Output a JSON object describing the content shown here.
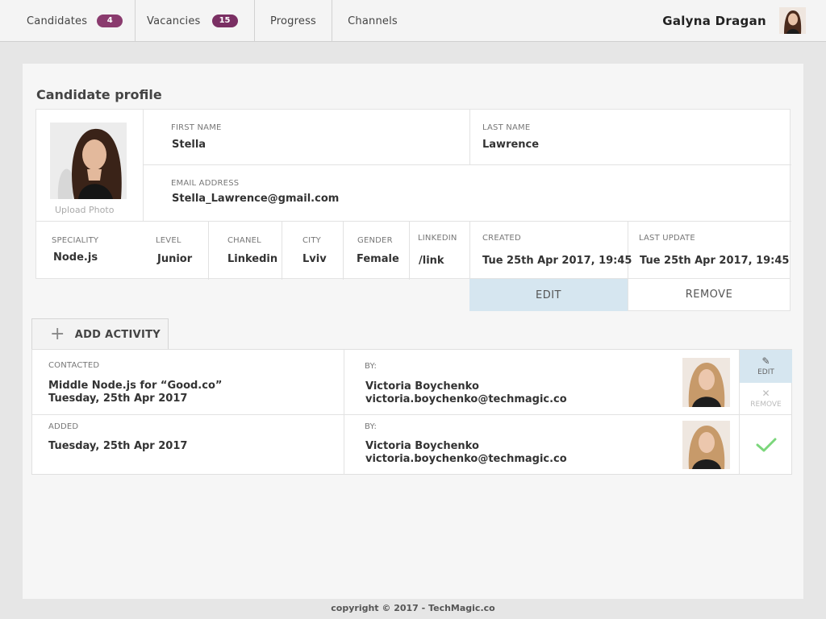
{
  "nav": {
    "items": [
      {
        "label": "Candidates",
        "badge": "4",
        "badge_color": "#8a3b6e"
      },
      {
        "label": "Vacancies",
        "badge": "15",
        "badge_color": "#7a2f63"
      },
      {
        "label": "Progress"
      },
      {
        "label": "Channels"
      }
    ],
    "user_name": "Galyna Dragan"
  },
  "profile": {
    "title": "Candidate profile",
    "upload_photo": "Upload Photo",
    "fields": {
      "first_name": {
        "label": "FIRST NAME",
        "value": "Stella"
      },
      "last_name": {
        "label": "LAST NAME",
        "value": "Lawrence"
      },
      "email": {
        "label": "EMAIL ADDRESS",
        "value": "Stella_Lawrence@gmail.com"
      },
      "speciality": {
        "label": "SPECIALITY",
        "value": "Node.js"
      },
      "level": {
        "label": "LEVEL",
        "value": "Junior"
      },
      "chanel": {
        "label": "CHANEL",
        "value": "Linkedin"
      },
      "city": {
        "label": "CITY",
        "value": "Lviv"
      },
      "gender": {
        "label": "GENDER",
        "value": "Female"
      },
      "linkedin": {
        "label": "LINKEDIN",
        "value": "/link"
      },
      "created": {
        "label": "CREATED",
        "value": "Tue 25th Apr 2017, 19:45"
      },
      "last_update": {
        "label": "LAST UPDATE",
        "value": "Tue 25th Apr 2017, 19:45"
      }
    },
    "edit_label": "EDIT",
    "remove_label": "REMOVE",
    "edit_bg": "#d6e6f0"
  },
  "activity": {
    "add_label": "ADD ACTIVITY",
    "rows": [
      {
        "type": "CONTACTED",
        "line1": "Middle Node.js for “Good.co”",
        "line2": "Tuesday, 25th Apr 2017",
        "by_label": "BY:",
        "by_name": "Victoria Boychenko",
        "by_email": "victoria.boychenko@techmagic.co",
        "edit_label": "EDIT",
        "remove_label": "REMOVE"
      },
      {
        "type": "ADDED",
        "line1": "Tuesday, 25th Apr 2017",
        "by_label": "BY:",
        "by_name": "Victoria Boychenko",
        "by_email": "victoria.boychenko@techmagic.co",
        "check_color": "#7bd67b"
      }
    ]
  },
  "footer": "copyright © 2017 - TechMagic.co"
}
